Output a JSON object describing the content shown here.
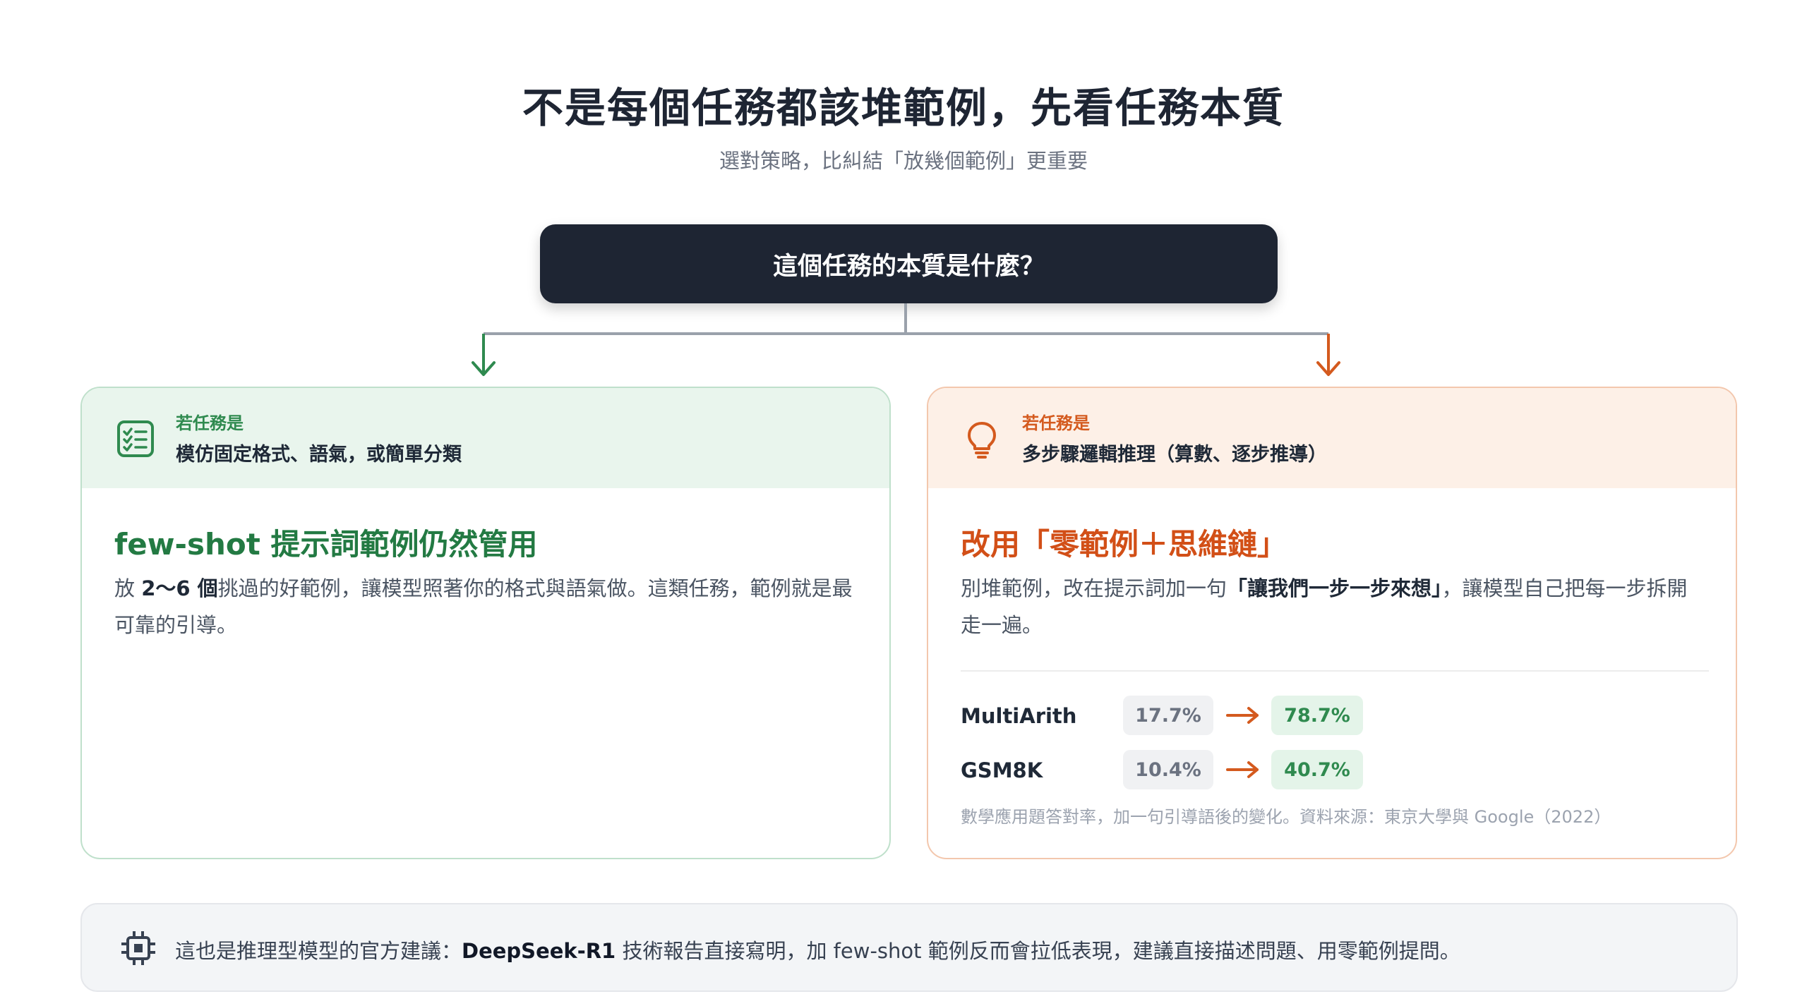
{
  "title": "不是每個任務都該堆範例，先看任務本質",
  "subtitle": "選對策略，比糾結「放幾個範例」更重要",
  "question": "這個任務的本質是什麼？",
  "colors": {
    "green": "#2f8a4f",
    "orange": "#d45a1e",
    "dark": "#1e2533"
  },
  "left_card": {
    "icon": "checklist-icon",
    "eyebrow": "若任務是",
    "condition": "模仿固定格式、語氣，或簡單分類",
    "title": "few-shot 提示詞範例仍然管用",
    "body_pre": "放 ",
    "body_bold": "2～6 個",
    "body_post": "挑過的好範例，讓模型照著你的格式與語氣做。這類任務，範例就是最可靠的引導。"
  },
  "right_card": {
    "icon": "lightbulb-icon",
    "eyebrow": "若任務是",
    "condition": "多步驟邏輯推理（算數、逐步推導）",
    "title": "改用「零範例＋思維鏈」",
    "body_pre": "別堆範例，改在提示詞加一句",
    "body_bold": "「讓我們一步一步來想」",
    "body_post": "，讓模型自己把每一步拆開走一遍。",
    "stats": [
      {
        "label": "MultiArith",
        "before": "17.7%",
        "after": "78.7%"
      },
      {
        "label": "GSM8K",
        "before": "10.4%",
        "after": "40.7%"
      }
    ],
    "note": "數學應用題答對率，加一句引導語後的變化。資料來源：東京大學與 Google（2022）"
  },
  "footer": {
    "icon": "chip-icon",
    "pre": "這也是推理型模型的官方建議：",
    "bold": "DeepSeek-R1",
    "post": " 技術報告直接寫明，加 few-shot 範例反而會拉低表現，建議直接描述問題、用零範例提問。"
  }
}
